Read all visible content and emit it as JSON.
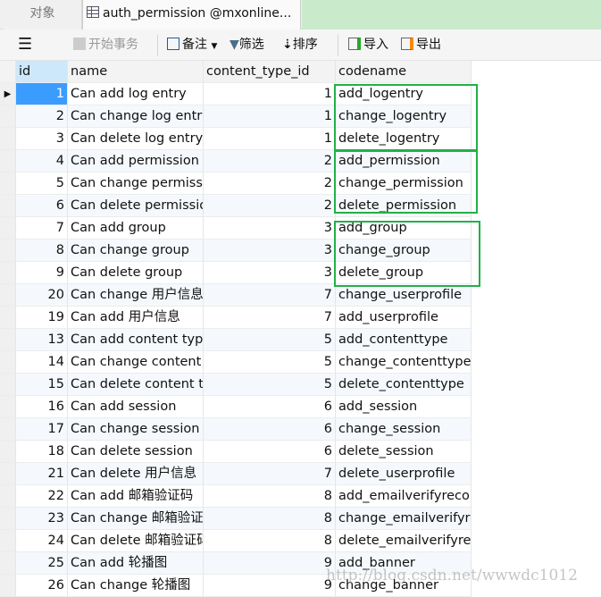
{
  "tabs": [
    {
      "label": "对象"
    },
    {
      "label": "auth_permission @mxonline..."
    }
  ],
  "toolbar": {
    "menu_icon": "hamburger-icon",
    "begin_transaction": "开始事务",
    "memo": "备注",
    "filter": "筛选",
    "sort": "排序",
    "import": "导入",
    "export": "导出"
  },
  "columns": [
    "id",
    "name",
    "content_type_id",
    "codename"
  ],
  "rows": [
    [
      "1",
      "Can add log entry",
      "1",
      "add_logentry"
    ],
    [
      "2",
      "Can change log entry",
      "1",
      "change_logentry"
    ],
    [
      "3",
      "Can delete log entry",
      "1",
      "delete_logentry"
    ],
    [
      "4",
      "Can add permission",
      "2",
      "add_permission"
    ],
    [
      "5",
      "Can change permissi",
      "2",
      "change_permission"
    ],
    [
      "6",
      "Can delete permissio",
      "2",
      "delete_permission"
    ],
    [
      "7",
      "Can add group",
      "3",
      "add_group"
    ],
    [
      "8",
      "Can change group",
      "3",
      "change_group"
    ],
    [
      "9",
      "Can delete group",
      "3",
      "delete_group"
    ],
    [
      "20",
      "Can change 用户信息",
      "7",
      "change_userprofile"
    ],
    [
      "19",
      "Can add 用户信息",
      "7",
      "add_userprofile"
    ],
    [
      "13",
      "Can add content typ",
      "5",
      "add_contenttype"
    ],
    [
      "14",
      "Can change content",
      "5",
      "change_contenttype"
    ],
    [
      "15",
      "Can delete content t",
      "5",
      "delete_contenttype"
    ],
    [
      "16",
      "Can add session",
      "6",
      "add_session"
    ],
    [
      "17",
      "Can change session",
      "6",
      "change_session"
    ],
    [
      "18",
      "Can delete session",
      "6",
      "delete_session"
    ],
    [
      "21",
      "Can delete 用户信息",
      "7",
      "delete_userprofile"
    ],
    [
      "22",
      "Can add 邮箱验证码",
      "8",
      "add_emailverifyreco"
    ],
    [
      "23",
      "Can change 邮箱验证",
      "8",
      "change_emailverifyre"
    ],
    [
      "24",
      "Can delete 邮箱验证码",
      "8",
      "delete_emailverifyre"
    ],
    [
      "25",
      "Can add 轮播图",
      "9",
      "add_banner"
    ],
    [
      "26",
      "Can change 轮播图",
      "9",
      "change_banner"
    ]
  ],
  "watermark": "http://blog.csdn.net/wwwdc1012",
  "colors": {
    "highlight_box": "#22b04a",
    "selected_cell": "#3b9cff",
    "tab_fill": "#c9ebcb"
  }
}
